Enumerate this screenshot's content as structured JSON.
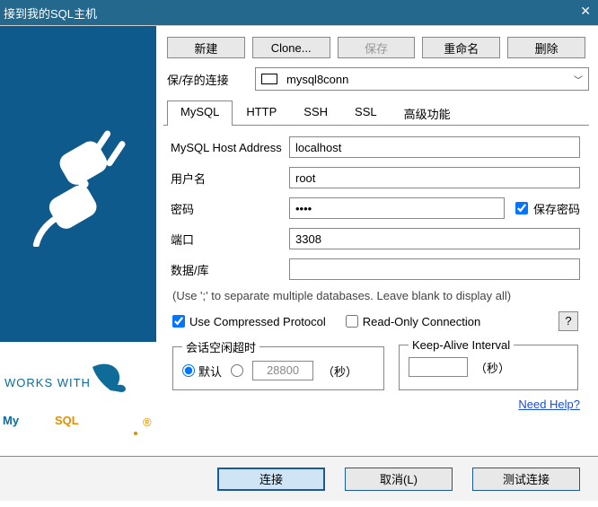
{
  "title": "接到我的SQL主机",
  "toolbar": {
    "new": "新建",
    "clone": "Clone...",
    "save": "保存",
    "rename": "重命名",
    "delete": "删除"
  },
  "saved": {
    "label": "保/存的连接",
    "value": "mysql8conn"
  },
  "tabs": {
    "mysql": "MySQL",
    "http": "HTTP",
    "ssh": "SSH",
    "ssl": "SSL",
    "advanced": "高级功能"
  },
  "form": {
    "host_label": "MySQL Host Address",
    "host_value": "localhost",
    "user_label": "用户名",
    "user_value": "root",
    "pass_label": "密码",
    "pass_value": "••••",
    "savepass_label": "保存密码",
    "port_label": "端口",
    "port_value": "3308",
    "db_label": "数据/库",
    "db_value": "",
    "db_note": "(Use ';' to separate multiple databases. Leave blank to display all)",
    "compress": "Use Compressed Protocol",
    "readonly": "Read-Only Connection",
    "help_q": "?",
    "idle_legend": "会话空闲超时",
    "idle_default": "默认",
    "idle_custom_value": "28800",
    "idle_unit": "（秒）",
    "keepalive_legend": "Keep-Alive Interval",
    "keepalive_value": "",
    "keepalive_unit": "（秒）",
    "need_help": "Need Help?"
  },
  "footer": {
    "connect": "连接",
    "cancel": "取消(L)",
    "test": "测试连接"
  },
  "logo": {
    "works_with": "WORKS WITH",
    "mysql": "MySQL"
  }
}
